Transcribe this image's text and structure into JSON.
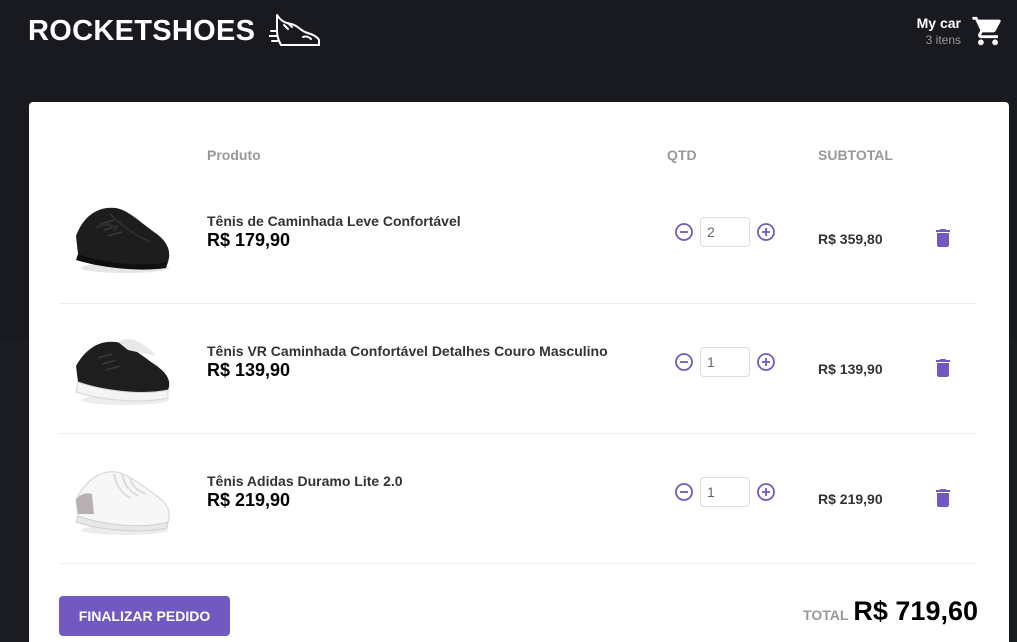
{
  "header": {
    "logo_text": "ROCKETSHOES",
    "cart_title": "My car",
    "cart_count": "3 itens"
  },
  "table": {
    "headers": {
      "product": "Produto",
      "qty": "QTD",
      "subtotal": "SUBTOTAL"
    },
    "rows": [
      {
        "title": "Tênis de Caminhada Leve Confortável",
        "price": "R$ 179,90",
        "qty": "2",
        "subtotal": "R$ 359,80",
        "image": "black-sneaker"
      },
      {
        "title": "Tênis VR Caminhada Confortável Detalhes Couro Masculino",
        "price": "R$ 139,90",
        "qty": "1",
        "subtotal": "R$ 139,90",
        "image": "black-white-sneaker"
      },
      {
        "title": "Tênis Adidas Duramo Lite 2.0",
        "price": "R$ 219,90",
        "qty": "1",
        "subtotal": "R$ 219,90",
        "image": "white-sneaker"
      }
    ]
  },
  "footer": {
    "finish_label": "FINALIZAR PEDIDO",
    "total_label": "TOTAL",
    "total_value": "R$ 719,60"
  },
  "colors": {
    "background": "#191920",
    "accent": "#7159c1",
    "panel": "#ffffff"
  },
  "icons": [
    "shoe-logo-icon",
    "cart-icon",
    "minus-circle-icon",
    "plus-circle-icon",
    "trash-icon"
  ]
}
